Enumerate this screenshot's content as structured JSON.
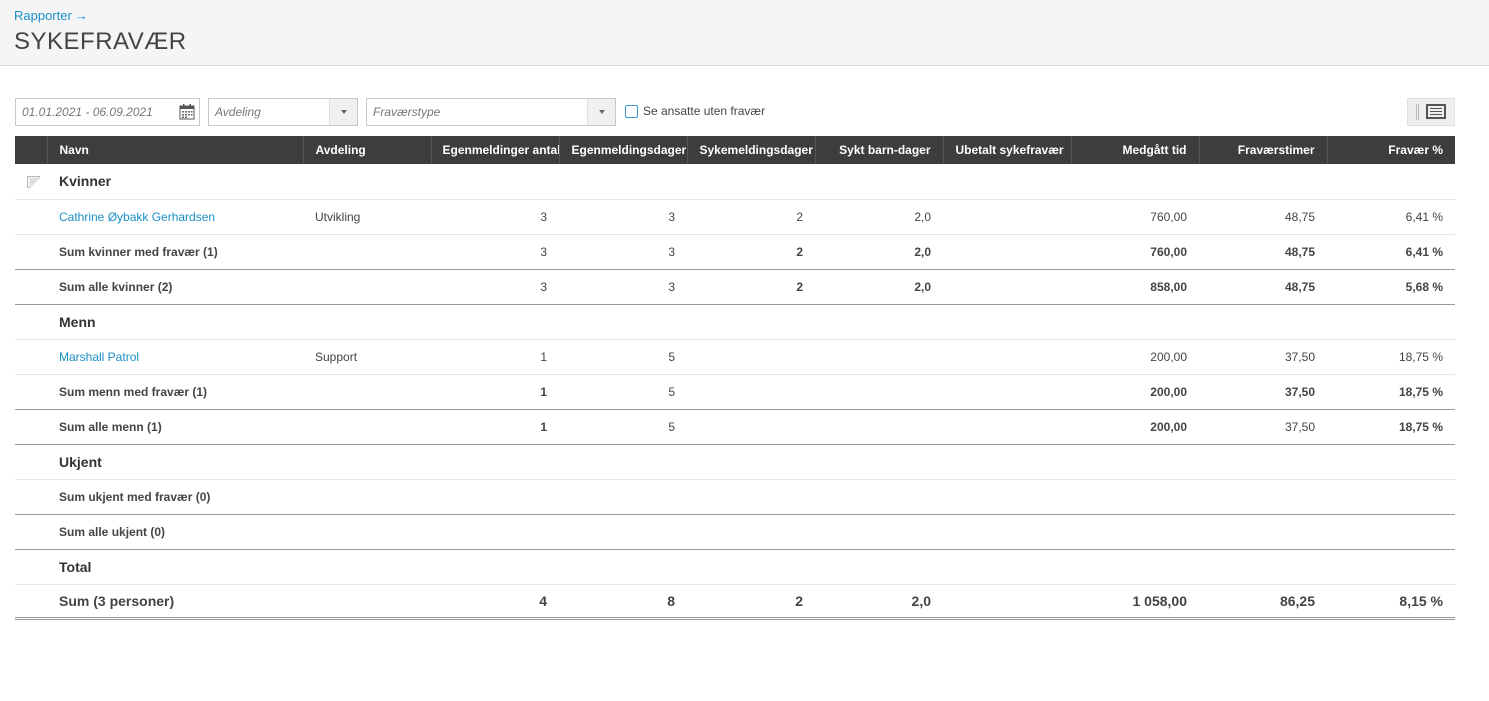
{
  "breadcrumb": {
    "parent": "Rapporter",
    "arrow": "→"
  },
  "page_title": "SYKEFRAVÆR",
  "filters": {
    "date_range": "01.01.2021 - 06.09.2021",
    "department_placeholder": "Avdeling",
    "absence_type_placeholder": "Fraværstype",
    "show_without_absence_label": "Se ansatte uten fravær",
    "show_without_absence_checked": false
  },
  "columns": {
    "name": "Navn",
    "department": "Avdeling",
    "self_cert_count": "Egenmeldinger antall",
    "self_cert_days": "Egenmeldingsdager",
    "sick_leave_days": "Sykemeldingsdager",
    "sick_child_days": "Sykt barn-dager",
    "unpaid_sick": "Ubetalt sykefravær",
    "time_used": "Medgått tid",
    "absence_hours": "Fraværstimer",
    "absence_pct": "Fravær %"
  },
  "groups": {
    "women": {
      "title": "Kvinner",
      "employee": {
        "name": "Cathrine Øybakk Gerhardsen",
        "department": "Utvikling",
        "self_cert_count": "3",
        "self_cert_days": "3",
        "sick_leave_days": "2",
        "sick_child_days": "2,0",
        "unpaid_sick": "",
        "time_used": "760,00",
        "absence_hours": "48,75",
        "absence_pct": "6,41 %"
      },
      "sum_with": {
        "label": "Sum kvinner med fravær (1)",
        "self_cert_count": "3",
        "self_cert_days": "3",
        "sick_leave_days": "2",
        "sick_child_days": "2,0",
        "time_used": "760,00",
        "absence_hours": "48,75",
        "absence_pct": "6,41 %"
      },
      "sum_all": {
        "label": "Sum alle kvinner (2)",
        "self_cert_count": "3",
        "self_cert_days": "3",
        "sick_leave_days": "2",
        "sick_child_days": "2,0",
        "time_used": "858,00",
        "absence_hours": "48,75",
        "absence_pct": "5,68 %"
      }
    },
    "men": {
      "title": "Menn",
      "employee": {
        "name": "Marshall Patrol",
        "department": "Support",
        "self_cert_count": "1",
        "self_cert_days": "5",
        "time_used": "200,00",
        "absence_hours": "37,50",
        "absence_pct": "18,75 %"
      },
      "sum_with": {
        "label": "Sum menn med fravær (1)",
        "self_cert_count": "1",
        "self_cert_days": "5",
        "time_used": "200,00",
        "absence_hours": "37,50",
        "absence_pct": "18,75 %"
      },
      "sum_all": {
        "label": "Sum alle menn (1)",
        "self_cert_count": "1",
        "self_cert_days": "5",
        "time_used": "200,00",
        "absence_hours": "37,50",
        "absence_pct": "18,75 %"
      }
    },
    "unknown": {
      "title": "Ukjent",
      "sum_with": {
        "label": "Sum ukjent med fravær (0)"
      },
      "sum_all": {
        "label": "Sum alle ukjent (0)"
      }
    }
  },
  "total": {
    "title": "Total",
    "label": "Sum (3 personer)",
    "self_cert_count": "4",
    "self_cert_days": "8",
    "sick_leave_days": "2",
    "sick_child_days": "2,0",
    "time_used": "1 058,00",
    "absence_hours": "86,25",
    "absence_pct": "8,15 %"
  }
}
